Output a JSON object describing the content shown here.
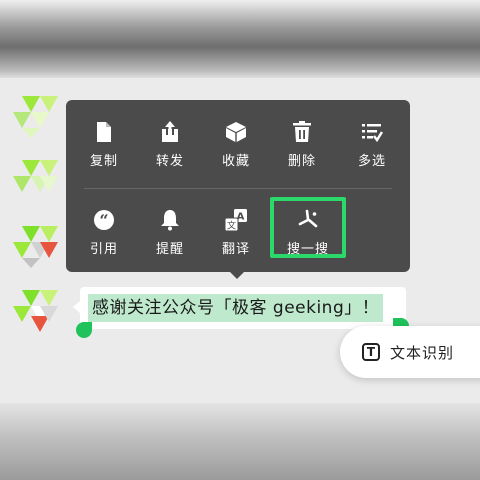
{
  "context_menu": {
    "row1": [
      {
        "label": "复制",
        "icon": "copy-icon"
      },
      {
        "label": "转发",
        "icon": "forward-icon"
      },
      {
        "label": "收藏",
        "icon": "favorite-icon"
      },
      {
        "label": "删除",
        "icon": "delete-icon"
      },
      {
        "label": "多选",
        "icon": "multi-select-icon"
      }
    ],
    "row2": [
      {
        "label": "引用",
        "icon": "quote-icon"
      },
      {
        "label": "提醒",
        "icon": "bell-icon"
      },
      {
        "label": "翻译",
        "icon": "translate-icon"
      },
      {
        "label": "搜一搜",
        "icon": "search-spark-icon"
      }
    ],
    "translate_icon_glyphs": {
      "a": "A",
      "b": "文"
    },
    "highlight_color": "#2bd96a"
  },
  "message": {
    "text": "感谢关注公众号「极客 geeking」！",
    "selection_color": "#bfe9cd",
    "handle_color": "#1fc25b"
  },
  "ocr_button": {
    "label": "文本识别",
    "icon_glyph": "T",
    "icon": "text-recognition-icon"
  },
  "colors": {
    "menu_bg": "#4b4b4b",
    "accent": "#1fc25b"
  }
}
